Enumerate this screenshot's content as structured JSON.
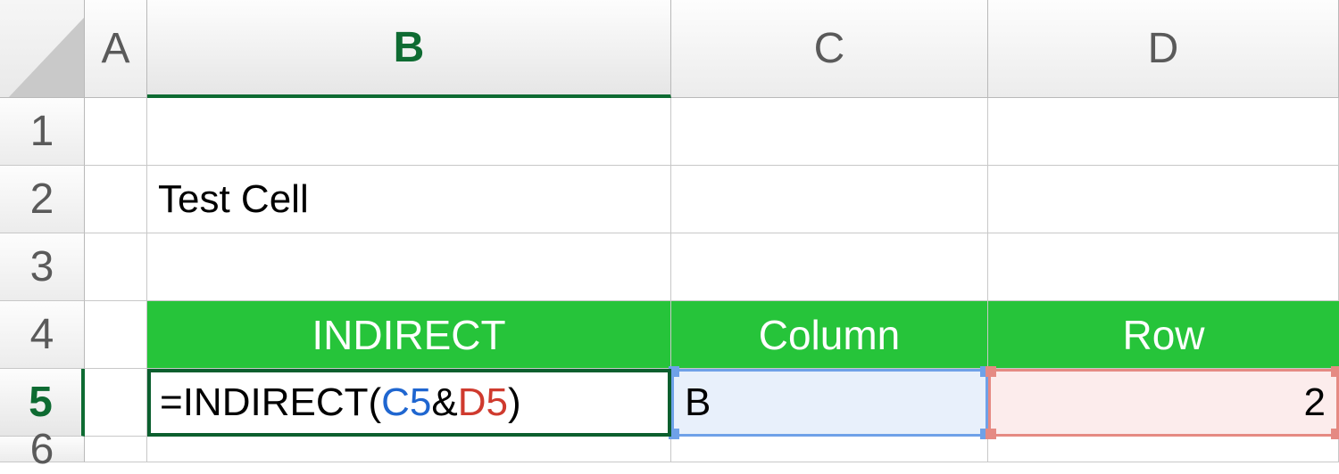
{
  "columns": {
    "A": "A",
    "B": "B",
    "C": "C",
    "D": "D"
  },
  "rows": {
    "r1": "1",
    "r2": "2",
    "r3": "3",
    "r4": "4",
    "r5": "5",
    "r6": "6"
  },
  "active": {
    "col": "B",
    "row": "5"
  },
  "cells": {
    "B2": "Test Cell",
    "B4": "INDIRECT",
    "C4": "Column",
    "D4": "Row",
    "C5": "B",
    "D5": "2"
  },
  "formula": {
    "prefix": "=INDIRECT(",
    "ref1": "C5",
    "amp": "&",
    "ref2": "D5",
    "suffix": ")"
  },
  "colors": {
    "green": "#26c43a",
    "darkGreen": "#0b5f2e",
    "blueRef": "#6fa1e8",
    "redRef": "#e58a83"
  }
}
